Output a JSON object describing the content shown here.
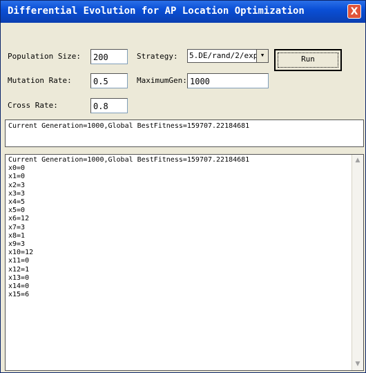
{
  "window": {
    "title": "Differential Evolution for AP Location Optimization",
    "close_label": "X"
  },
  "form": {
    "population_label": "Population Size:",
    "population_value": "200",
    "mutation_label": "Mutation Rate:",
    "mutation_value": "0.5",
    "cross_label": "Cross Rate:",
    "cross_value": "0.8",
    "strategy_label": "Strategy:",
    "strategy_value": "5.DE/rand/2/exp",
    "maxgen_label": "MaximumGen:",
    "maxgen_value": "1000",
    "run_label": "Run"
  },
  "status": {
    "text": "Current Generation=1000,Global BestFitness=159707.22184681"
  },
  "output": {
    "header": "Current Generation=1000,Global BestFitness=159707.22184681",
    "lines": [
      "x0=0",
      "x1=0",
      "x2=3",
      "x3=3",
      "x4=5",
      "x5=0",
      "x6=12",
      "x7=3",
      "x8=1",
      "x9=3",
      "x10=12",
      "x11=0",
      "x12=1",
      "x13=0",
      "x14=0",
      "x15=6"
    ]
  },
  "scroll": {
    "up_icon": "▲",
    "down_icon": "▼"
  }
}
